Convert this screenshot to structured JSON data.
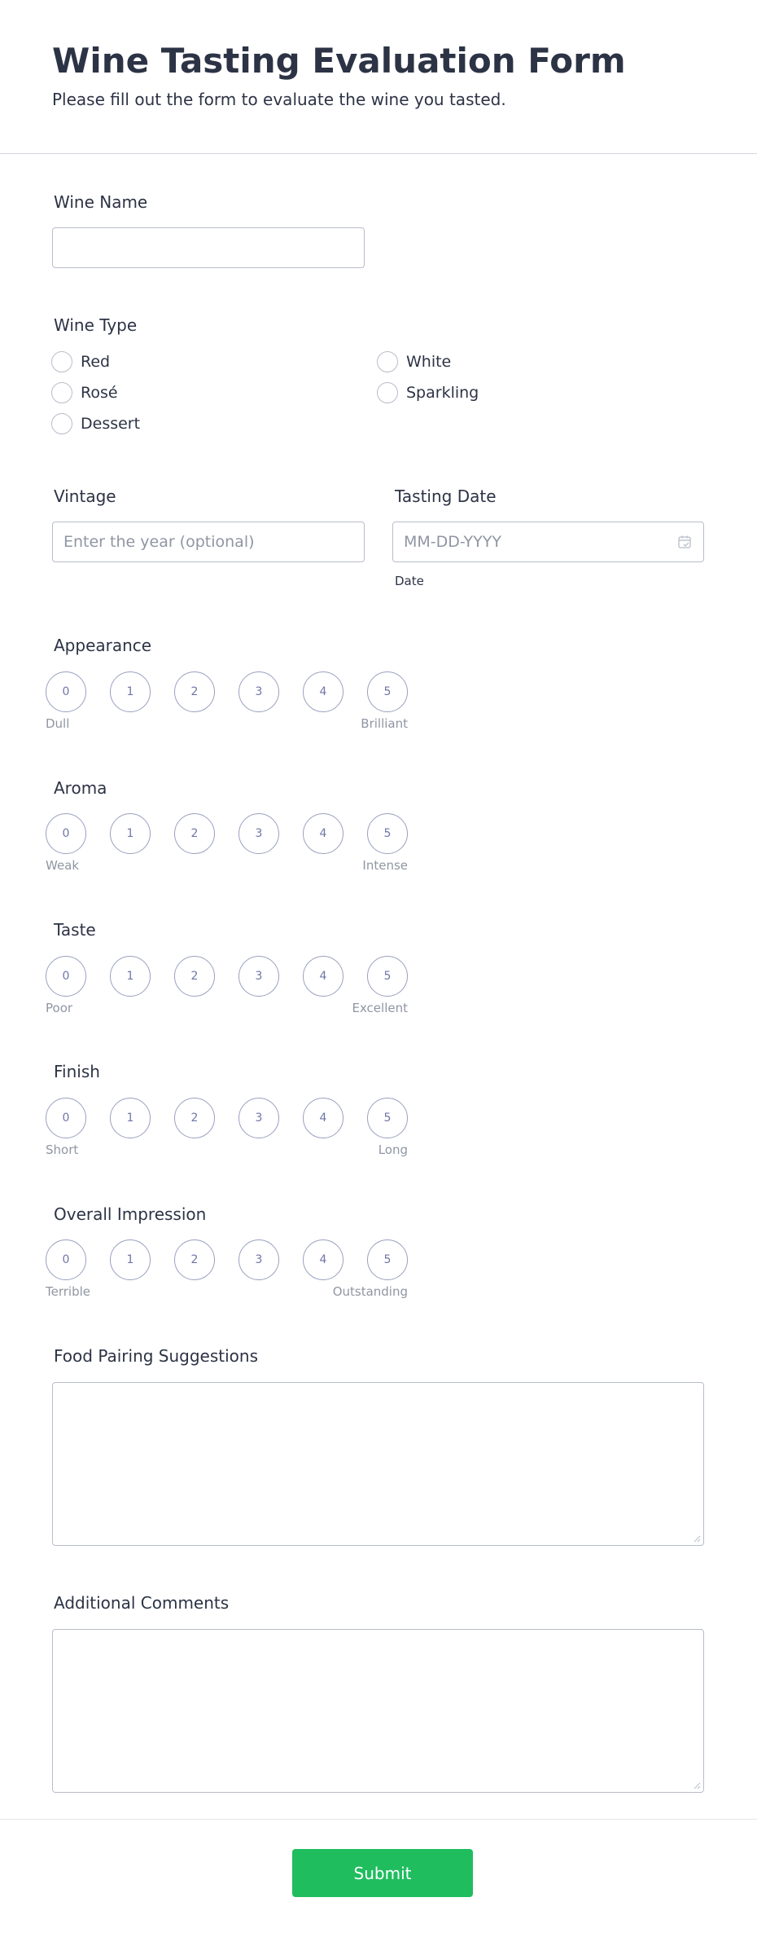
{
  "header": {
    "title": "Wine Tasting Evaluation Form",
    "subtitle": "Please fill out the form to evaluate the wine you tasted."
  },
  "wine_name": {
    "label": "Wine Name",
    "value": ""
  },
  "wine_type": {
    "label": "Wine Type",
    "options": [
      "Red",
      "White",
      "Rosé",
      "Sparkling",
      "Dessert"
    ]
  },
  "vintage": {
    "label": "Vintage",
    "placeholder": "Enter the year (optional)"
  },
  "tasting_date": {
    "label": "Tasting Date",
    "placeholder": "MM-DD-YYYY",
    "sublabel": "Date"
  },
  "scales": [
    {
      "label": "Appearance",
      "values": [
        "0",
        "1",
        "2",
        "3",
        "4",
        "5"
      ],
      "low": "Dull",
      "high": "Brilliant"
    },
    {
      "label": "Aroma",
      "values": [
        "0",
        "1",
        "2",
        "3",
        "4",
        "5"
      ],
      "low": "Weak",
      "high": "Intense"
    },
    {
      "label": "Taste",
      "values": [
        "0",
        "1",
        "2",
        "3",
        "4",
        "5"
      ],
      "low": "Poor",
      "high": "Excellent"
    },
    {
      "label": "Finish",
      "values": [
        "0",
        "1",
        "2",
        "3",
        "4",
        "5"
      ],
      "low": "Short",
      "high": "Long"
    },
    {
      "label": "Overall Impression",
      "values": [
        "0",
        "1",
        "2",
        "3",
        "4",
        "5"
      ],
      "low": "Terrible",
      "high": "Outstanding"
    }
  ],
  "food_pairing": {
    "label": "Food Pairing Suggestions",
    "value": ""
  },
  "comments": {
    "label": "Additional Comments",
    "value": ""
  },
  "submit": {
    "label": "Submit"
  },
  "colors": {
    "accent": "#1fbd5e",
    "scale_border": "#9aa0c0",
    "scale_text": "#6f76a7",
    "text": "#2c3345"
  }
}
